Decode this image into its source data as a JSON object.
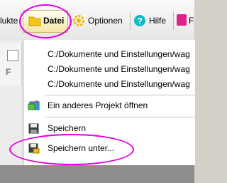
{
  "menubar": {
    "items": [
      {
        "label": "lukte"
      },
      {
        "label": "Datei",
        "icon": "folder-icon"
      },
      {
        "label": "Optionen",
        "icon": "gear-icon"
      },
      {
        "label": "Hilfe",
        "icon": "help-icon"
      },
      {
        "label": "F"
      }
    ]
  },
  "left_panel": {
    "letter": "F"
  },
  "file_menu": {
    "recent_files": [
      "C:/Dokumente und Einstellungen/wag",
      "C:/Dokumente und Einstellungen/wag",
      "C:/Dokumente und Einstellungen/wag"
    ],
    "open_other_project": "Ein anderes Projekt öffnen",
    "save": "Speichern",
    "save_as": "Speichern unter..."
  },
  "colors": {
    "highlight_ellipse": "#e000e0",
    "active_tab": "#f3e6a6"
  }
}
